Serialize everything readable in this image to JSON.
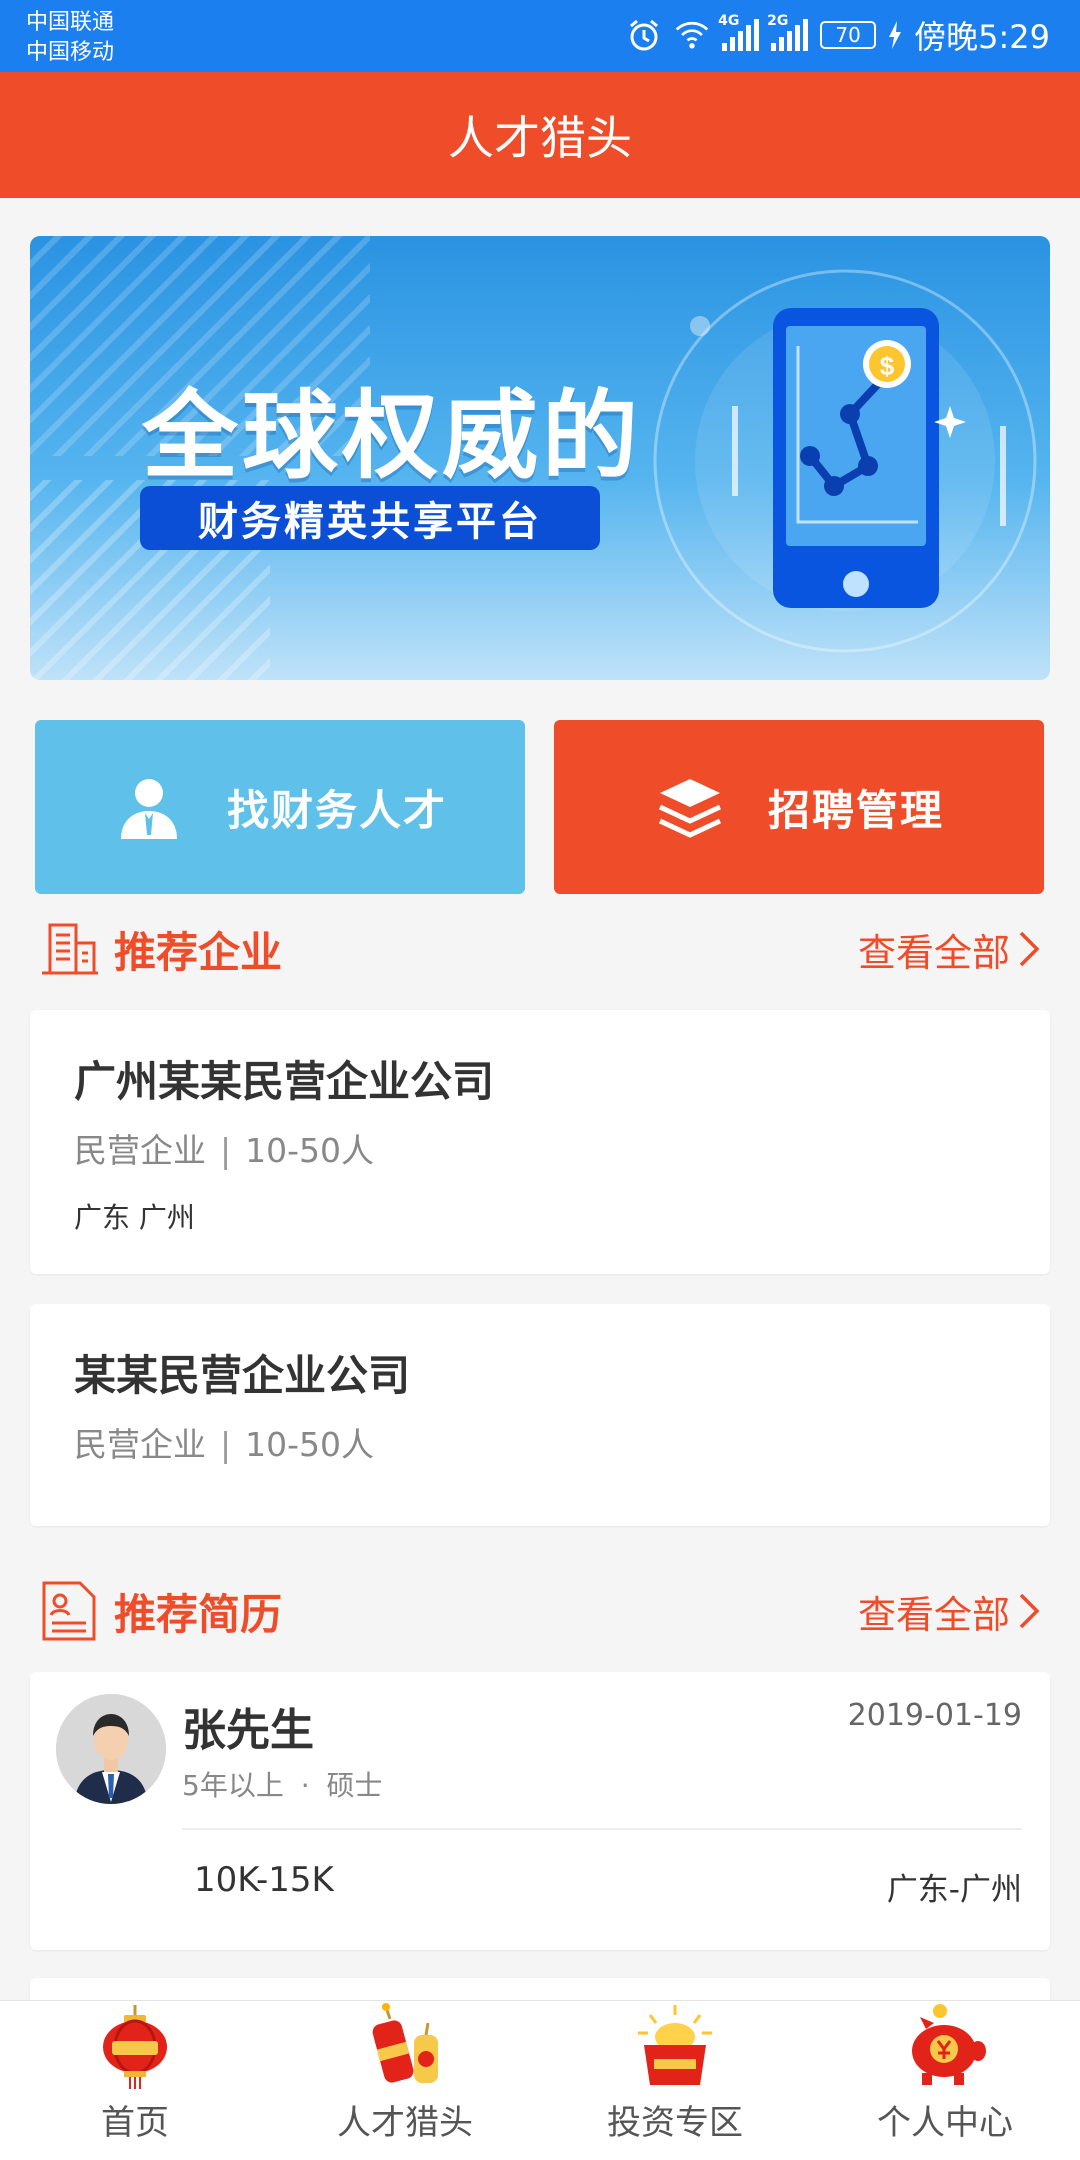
{
  "status_bar": {
    "carrier_1": "中国联通",
    "carrier_2": "中国移动",
    "signal_1_label": "4G",
    "signal_2_label": "2G",
    "battery": "70",
    "time": "傍晚5:29"
  },
  "header": {
    "title": "人才猎头"
  },
  "banner": {
    "headline": "全球权威的",
    "subline": "财务精英共享平台",
    "coin_symbol": "$"
  },
  "actions": {
    "find_talent": "找财务人才",
    "recruit_manage": "招聘管理"
  },
  "companies_section": {
    "title": "推荐企业",
    "view_all": "查看全部",
    "items": [
      {
        "name": "广州某某民营企业公司",
        "type": "民营企业",
        "size": "10-50人",
        "location": "广东 广州"
      },
      {
        "name": "某某民营企业公司",
        "type": "民营企业",
        "size": "10-50人",
        "location": ""
      }
    ],
    "separator": "|"
  },
  "resumes_section": {
    "title": "推荐简历",
    "view_all": "查看全部",
    "items": [
      {
        "name": "张先生",
        "date": "2019-01-19",
        "experience": "5年以上",
        "dot": "·",
        "education": "硕士",
        "salary": "10K-15K",
        "location": "广东-广州"
      }
    ]
  },
  "tabs": [
    {
      "label": "首页",
      "icon": "lantern-icon"
    },
    {
      "label": "人才猎头",
      "icon": "firecracker-icon"
    },
    {
      "label": "投资专区",
      "icon": "gold-ingot-icon"
    },
    {
      "label": "个人中心",
      "icon": "piggy-bank-icon"
    }
  ],
  "colors": {
    "brand": "#ef4c2a",
    "status_bar": "#1b7ff0",
    "find_button": "#5fc1ea"
  }
}
